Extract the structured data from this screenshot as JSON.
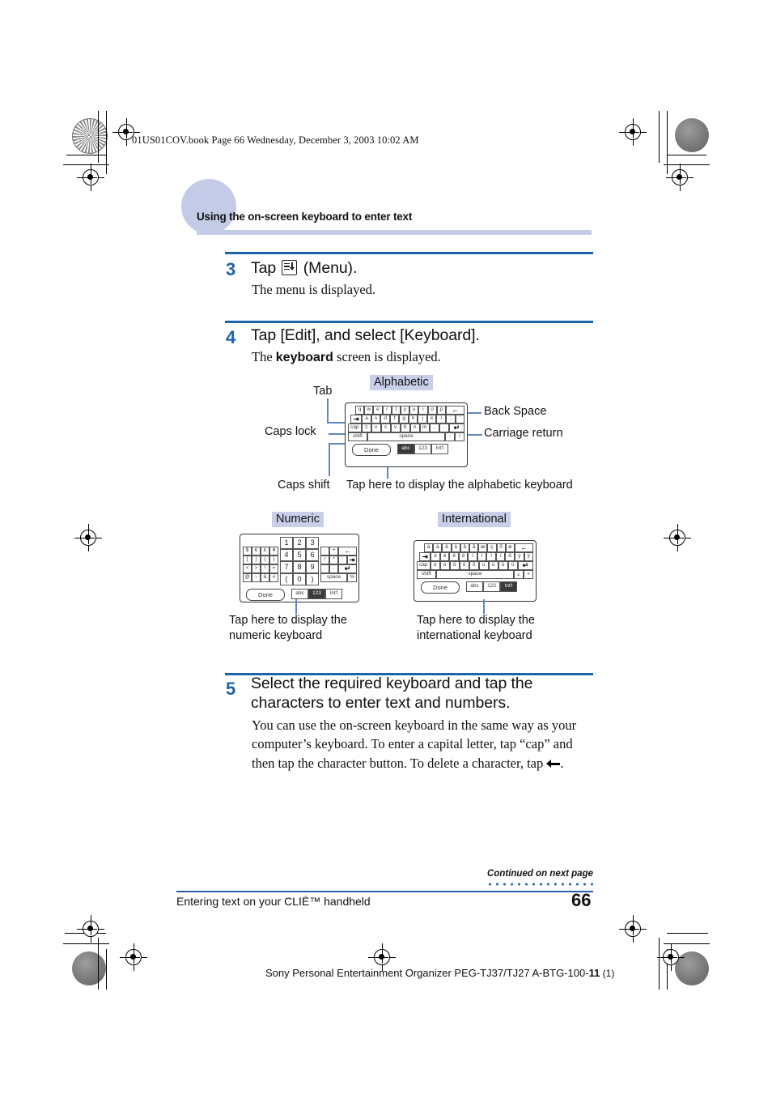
{
  "print": {
    "book_line": "01US01COV.book  Page 66  Wednesday, December 3, 2003  10:02 AM"
  },
  "section_header": {
    "title": "Using the on-screen keyboard to enter text",
    "accent_color": "#c3cbe6"
  },
  "steps": [
    {
      "number": "3",
      "heading_prefix": "Tap ",
      "heading_icon": "menu-icon",
      "heading_suffix": " (Menu).",
      "body": "The menu is displayed."
    },
    {
      "number": "4",
      "heading": "Tap [Edit], and select [Keyboard].",
      "body_prefix": "The ",
      "body_bold": "keyboard",
      "body_suffix": " screen is displayed."
    },
    {
      "number": "5",
      "heading_line1": "Select the required keyboard and tap the",
      "heading_line2": "characters to enter text and numbers.",
      "body_line1": "You can use the on-screen keyboard in the same way as your",
      "body_line2": "computer’s keyboard. To enter a capital letter, tap “cap” and",
      "body_line3_prefix": "then tap the character button. To delete a character, tap ",
      "body_line3_icon": "back-space-arrow-icon",
      "body_line3_suffix": "."
    }
  ],
  "figures": {
    "alphabetic": {
      "title": "Alphabetic",
      "callouts": {
        "tab": "Tab",
        "caps_lock": "Caps lock",
        "caps_shift": "Caps shift",
        "back_space": "Back Space",
        "carriage_return": "Carriage return",
        "tap_here": "Tap here to display the alphabetic keyboard"
      },
      "rows": [
        [
          "q",
          "w",
          "e",
          "r",
          "t",
          "y",
          "u",
          "i",
          "o",
          "p"
        ],
        [
          "a",
          "s",
          "d",
          "f",
          "g",
          "h",
          "j",
          "k",
          "l",
          ";",
          "'"
        ],
        [
          "z",
          "x",
          "c",
          "v",
          "b",
          "n",
          "m",
          ",",
          "."
        ],
        []
      ],
      "tab_key": "⇥",
      "cap_key": "cap",
      "shift_key": "shift",
      "space_key": "space",
      "back_space_key": "←",
      "return_key": "↵",
      "dash_key": "-",
      "slash_key": "/",
      "done_label": "Done",
      "mode_keys": [
        "abc",
        "123",
        "Int'l"
      ],
      "active_mode": "abc"
    },
    "numeric": {
      "title": "Numeric",
      "caption_line1": "Tap here to display the",
      "caption_line2": "numeric keyboard",
      "left_block": [
        [
          "$",
          "€",
          "£",
          "¥"
        ],
        [
          "[",
          "]",
          "{",
          "}"
        ],
        [
          "<",
          ">",
          "\\",
          "="
        ],
        [
          "@",
          "~",
          "&",
          "#"
        ]
      ],
      "digit_block": [
        [
          "1",
          "2",
          "3"
        ],
        [
          "4",
          "5",
          "6"
        ],
        [
          "7",
          "8",
          "9"
        ],
        [
          "(",
          "0",
          ")"
        ]
      ],
      "right_block": [
        [
          "-",
          "+",
          "←"
        ],
        [
          "/",
          "*",
          ":",
          "⇥"
        ],
        [
          ".",
          ",",
          "↵"
        ],
        [
          "space",
          "%"
        ]
      ],
      "done_label": "Done",
      "mode_keys": [
        "abc",
        "123",
        "Int'l"
      ],
      "active_mode": "123"
    },
    "international": {
      "title": "International",
      "caption_line1": "Tap here to display the",
      "caption_line2": "international keyboard",
      "rows": [
        [
          "á",
          "à",
          "â",
          "ä",
          "å",
          "ã",
          "æ",
          "ç",
          "ñ",
          "ø"
        ],
        [
          "é",
          "è",
          "ê",
          "ë",
          "ì",
          "í",
          "î",
          "ï",
          "ß",
          "ý",
          "ÿ"
        ],
        [
          "ó",
          "ò",
          "ô",
          "ö",
          "õ",
          "ú",
          "ù",
          "û",
          "ü"
        ]
      ],
      "tab_key": "⇥",
      "cap_key": "cap",
      "shift_key": "shift",
      "space_key": "space",
      "back_space_key": "←",
      "return_key": "↵",
      "extra_keys": [
        "¿",
        "«"
      ],
      "done_label": "Done",
      "mode_keys": [
        "abc",
        "123",
        "Int'l"
      ],
      "active_mode": "Int'l"
    }
  },
  "footer": {
    "continued": "Continued on next page",
    "running_head": "Entering text on your CLIÉ™ handheld",
    "page_number": "66",
    "colophon_main": "Sony Personal Entertainment Organizer  PEG-TJ37/TJ27  A-BTG-100-",
    "colophon_bold": "11",
    "colophon_paren": " (1)"
  }
}
